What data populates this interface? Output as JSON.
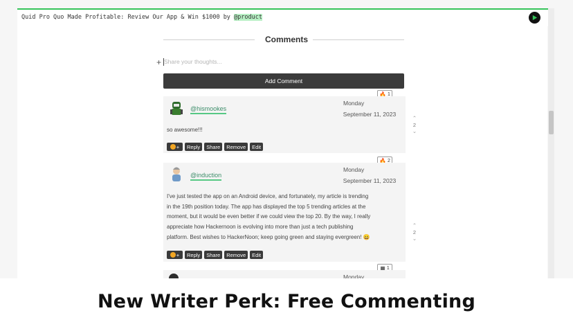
{
  "topbar": {
    "title_prefix": "Quid Pro Quo Made Profitable: Review Our App & Win $1000 by ",
    "title_handle": "@product",
    "accent_color": "#35c35a"
  },
  "comments": {
    "title": "Comments",
    "input_placeholder": "Share your thoughts...",
    "add_button_label": "Add Comment",
    "items": [
      {
        "handle": "@hismookes",
        "weekday": "Monday",
        "date": "September 11, 2023",
        "text": "so awesome!!!",
        "reaction_count": "1",
        "vote_count": "2"
      },
      {
        "handle": "@induction",
        "weekday": "Monday",
        "date": "September 11, 2023",
        "text_lines": [
          "I've just tested the app on an Android device, and fortunately, my article is trending",
          "in the 19th position today. The app has displayed the top 5 trending articles at the",
          "moment, but it would be even better if we could view the top 20. By the way, I really",
          "appreciate how Hackernoon is evolving into more than just a tech publishing",
          "platform. Best wishes to HackerNoon; keep going green and staying evergreen! 😄"
        ],
        "reaction_count": "2",
        "vote_count": "2"
      },
      {
        "weekday": "Monday",
        "reaction_count": "1"
      }
    ],
    "action_labels": {
      "emoji": "+",
      "reply": "Reply",
      "share": "Share",
      "remove": "Remove",
      "edit": "Edit"
    },
    "icons": {
      "reaction": "fire-icon",
      "upvote": "chevron-up-icon",
      "downvote": "chevron-down-icon",
      "add": "plus-icon"
    }
  },
  "caption": "New Writer Perk: Free Commenting"
}
